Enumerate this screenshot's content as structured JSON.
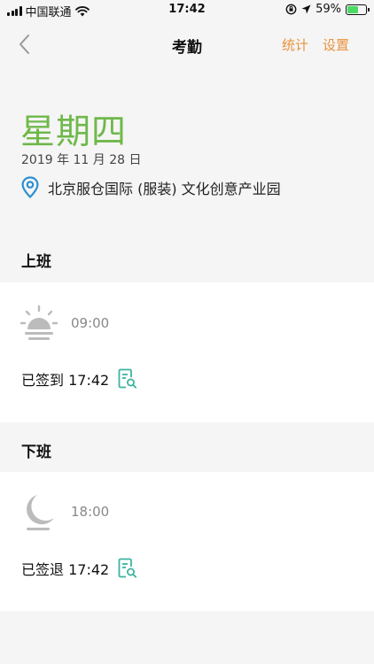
{
  "status_bar": {
    "carrier": "中国联通",
    "time": "17:42",
    "battery": "59%",
    "battery_level": 0.59
  },
  "nav": {
    "title": "考勤",
    "stats_label": "统计",
    "settings_label": "设置"
  },
  "header": {
    "weekday": "星期四",
    "date": "2019 年 11 月 28 日",
    "location": "北京服仓国际 (服装) 文化创意产业园"
  },
  "on_duty": {
    "label": "上班",
    "scheduled_time": "09:00",
    "signed_text": "已签到 17:42"
  },
  "off_duty": {
    "label": "下班",
    "scheduled_time": "18:00",
    "signed_text": "已签退 17:42"
  },
  "colors": {
    "accent_green": "#6fb84a",
    "accent_orange": "#e8913a",
    "location_blue": "#2e8fd0",
    "record_teal": "#3bb5a0"
  }
}
